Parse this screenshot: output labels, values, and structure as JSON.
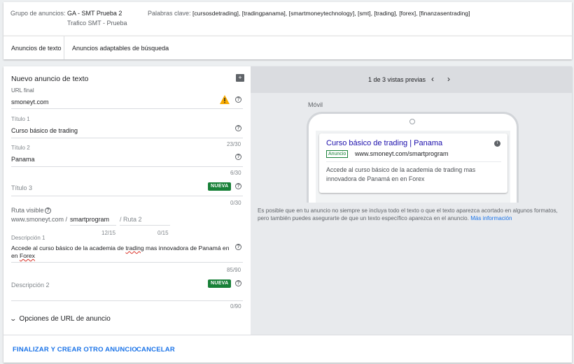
{
  "header": {
    "ad_group_label": "Grupo de anuncios:",
    "ad_group_name": "GA - SMT Prueba 2",
    "campaign_name": "Trafico SMT - Prueba",
    "keywords_label": "Palabras clave:",
    "keywords": "[cursosdetrading], [tradingpanama], [smartmoneytechnology], [smt], [trading], [forex], [finanzasentrading]"
  },
  "tabs": [
    "Anuncios de texto",
    "Anuncios adaptables de búsqueda"
  ],
  "form": {
    "title": "Nuevo anuncio de texto",
    "final_url": {
      "label": "URL final",
      "value": "smoneyt.com"
    },
    "headline1": {
      "label": "Título 1",
      "value": "Curso básico de trading"
    },
    "headline2": {
      "label": "Título 2",
      "value": "Panama",
      "counter_above": "23/30",
      "counter": "6/30"
    },
    "headline3": {
      "label": "Título 3",
      "badge": "NUEVA",
      "counter": "0/30"
    },
    "display_path": {
      "label": "Ruta visible",
      "base": "www.smoneyt.com /",
      "path1": "smartprogram",
      "path2_placeholder": "/ Ruta 2",
      "counter1": "12/15",
      "counter2": "0/15"
    },
    "description1": {
      "label": "Descripción 1",
      "value_before": "Accede al curso básico de la academia de ",
      "value_typo1": "trading",
      "value_middle": " mas innovadora de Panamá en en ",
      "value_typo2": "Forex",
      "counter": "85/90"
    },
    "description2": {
      "label": "Descripción 2",
      "badge": "NUEVA",
      "counter": "0/90"
    },
    "url_options": "Opciones de URL de anuncio"
  },
  "preview": {
    "pager": "1 de 3 vistas previas",
    "device": "Móvil",
    "ad_headline": "Curso básico de trading | Panama",
    "ad_badge": "Anuncio",
    "ad_url": "www.smoneyt.com/smartprogram",
    "ad_description": "Accede al curso básico de la academia de trading mas innovadora de Panamá en en Forex",
    "disclaimer": "Es posible que en tu anuncio no siempre se incluya todo el texto o que el texto aparezca acortado en algunos formatos, pero también puedes asegurarte de que un texto específico aparezca en el anuncio.",
    "more_info": "Más información"
  },
  "footer": {
    "save_label": "FINALIZAR Y CREAR OTRO ANUNCIO",
    "cancel_label": "CANCELAR"
  },
  "colors": {
    "accent": "#1a73e8",
    "badge": "#188038",
    "warning": "#f9ab00"
  }
}
